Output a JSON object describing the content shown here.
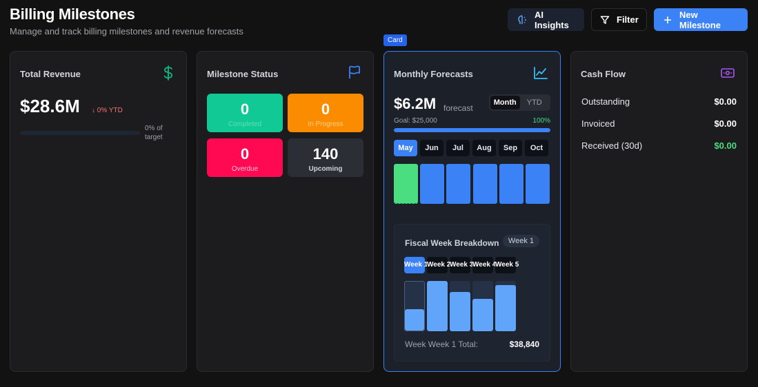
{
  "header": {
    "title": "Billing Milestones",
    "subtitle": "Manage and track billing milestones and revenue forecasts"
  },
  "toolbar": {
    "ai_label": "AI Insights",
    "filter_label": "Filter",
    "new_label": "New Milestone"
  },
  "card_tag": "Card",
  "revenue": {
    "title": "Total Revenue",
    "amount": "$28.6M",
    "change": "0% YTD",
    "change_arrow": "↓",
    "target_text": "0% of target",
    "target_progress": 0
  },
  "status": {
    "title": "Milestone Status",
    "tiles": [
      {
        "count": "0",
        "label": "Completed",
        "bg": "#10c995",
        "fg": "#5be3b4"
      },
      {
        "count": "0",
        "label": "In Progress",
        "bg": "#fb8c00",
        "fg": "#ffd08a"
      },
      {
        "count": "0",
        "label": "Overdue",
        "bg": "#ff0a52",
        "fg": "#ffc2d2"
      },
      {
        "count": "140",
        "label": "Upcoming",
        "bg": "#2b2e34",
        "fg": "#d1d5db"
      }
    ]
  },
  "forecast": {
    "title": "Monthly Forecasts",
    "amount": "$6.2M",
    "unit": "forecast",
    "toggle": [
      "Month",
      "YTD"
    ],
    "toggle_selected": "Month",
    "goal_label": "Goal: $25,000",
    "goal_pct": "100%",
    "goal_progress": 1.0,
    "months": [
      "May",
      "Jun",
      "Jul",
      "Aug",
      "Sep",
      "Oct"
    ],
    "month_selected": "May",
    "month_levels": [
      1.0,
      1.0,
      1.0,
      1.0,
      1.0,
      1.0
    ],
    "week_panel": {
      "title": "Fiscal Week Breakdown",
      "badge": "Week 1",
      "weeks": [
        "Week 1",
        "Week 2",
        "Week 3",
        "Week 4",
        "Week 5"
      ],
      "week_selected": "Week 1",
      "week_levels": [
        0.42,
        1.0,
        0.78,
        0.64,
        0.92
      ],
      "total_label": "Week Week 1 Total:",
      "total_value": "$38,840"
    }
  },
  "cashflow": {
    "title": "Cash Flow",
    "rows": [
      {
        "label": "Outstanding",
        "value": "$0.00",
        "color": "#ffffff"
      },
      {
        "label": "Invoiced",
        "value": "$0.00",
        "color": "#ffffff"
      },
      {
        "label": "Received (30d)",
        "value": "$0.00",
        "color": "#4ade80"
      }
    ]
  },
  "colors": {
    "accent": "#3b82f6",
    "success": "#4ade80",
    "danger": "#f87171"
  }
}
